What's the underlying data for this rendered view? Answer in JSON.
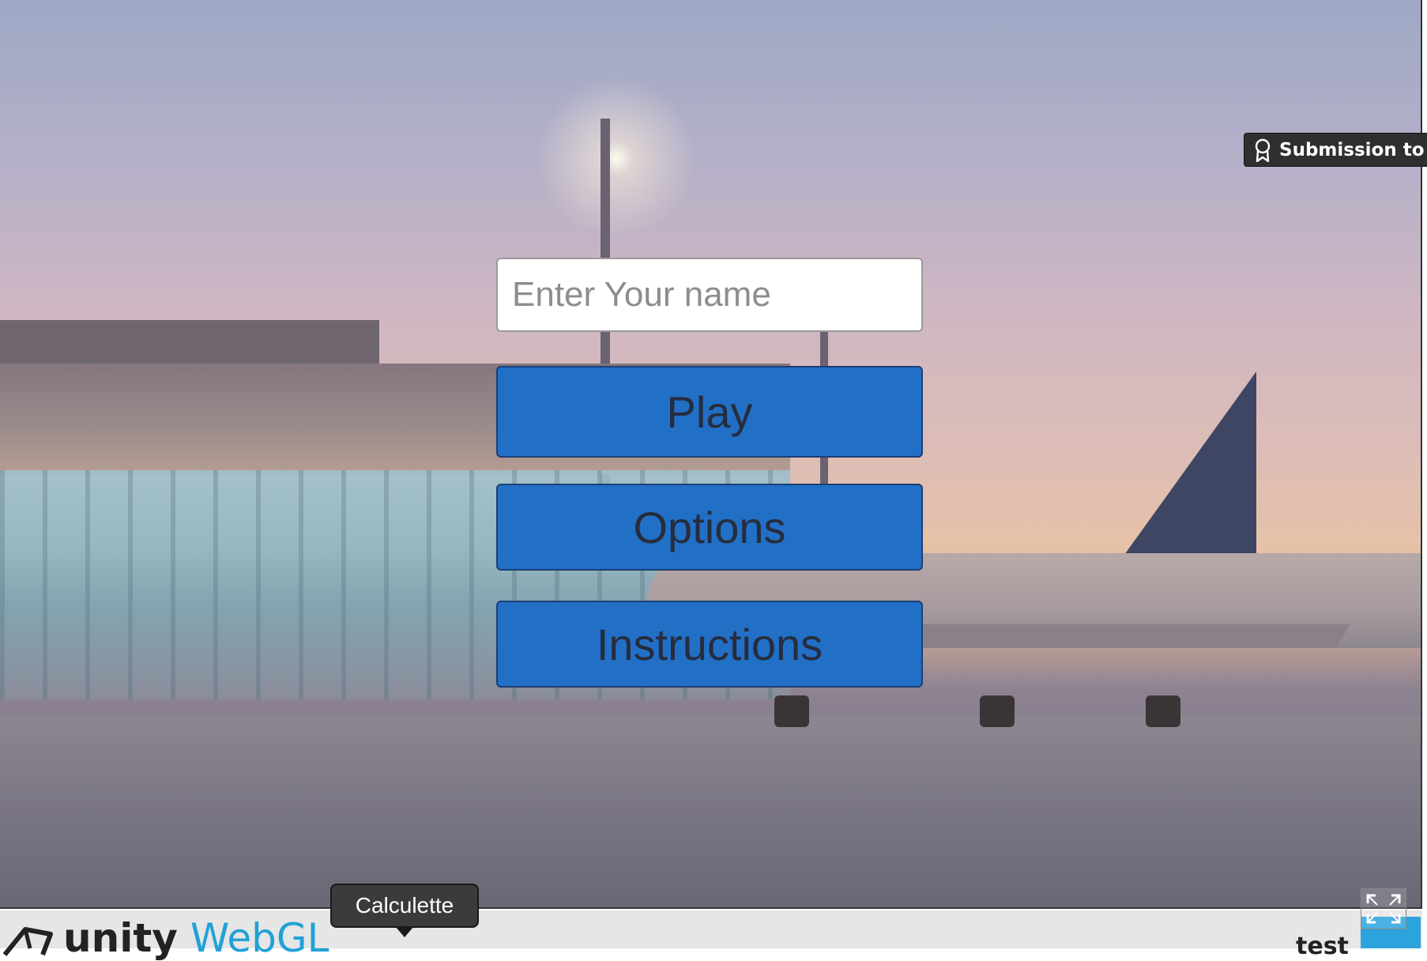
{
  "menu": {
    "name_placeholder": "Enter Your name",
    "play_label": "Play",
    "options_label": "Options",
    "instructions_label": "Instructions"
  },
  "badge": {
    "label": "Submission to Sp",
    "icon": "award-ribbon-icon"
  },
  "footer": {
    "unity_text": "unity",
    "webgl_text": "WebGL",
    "title": "test",
    "tooltip": "Calculette",
    "fullscreen_icon": "fullscreen-icon"
  },
  "colors": {
    "button": "#226fc6",
    "button_text": "#262d3d",
    "webgl_accent": "#21a1d6"
  }
}
